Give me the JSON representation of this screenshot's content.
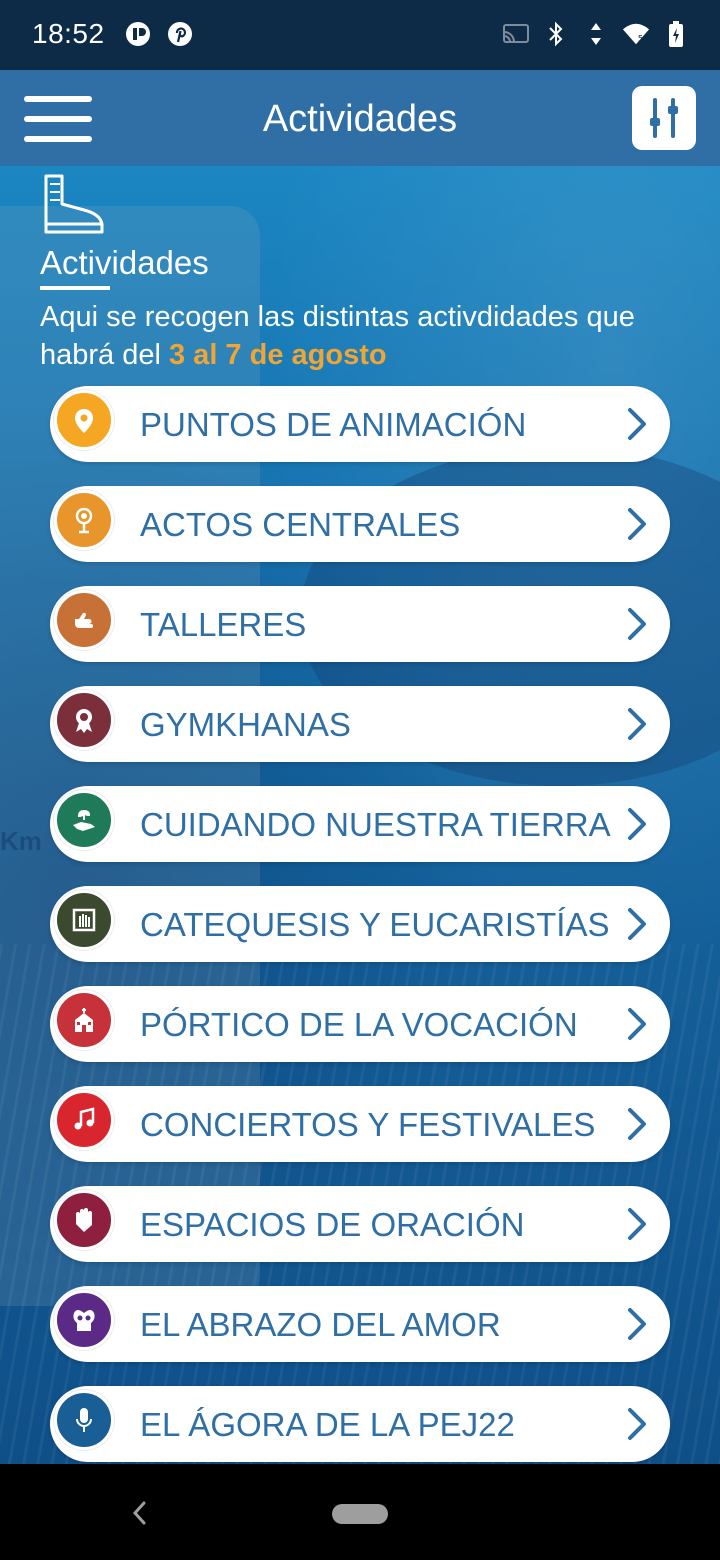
{
  "status_bar": {
    "time": "18:52",
    "left_icons": [
      "notification-app-icon",
      "pinterest-icon"
    ],
    "right_icons": [
      "cast-icon",
      "bluetooth-icon",
      "data-arrows-icon",
      "wifi-icon",
      "battery-icon"
    ]
  },
  "app_bar": {
    "title": "Actividades",
    "menu_icon": "hamburger-icon",
    "filter_icon": "sliders-icon"
  },
  "section": {
    "icon": "boot-icon",
    "title": "Actividades",
    "desc_prefix": "Aqui se recogen las distintas activdidades que habrá del ",
    "desc_highlight": "3 al 7 de agosto"
  },
  "colors": {
    "app_bar": "#2f6fa5",
    "status_bar": "#0d2a47",
    "item_text": "#2f6fa5",
    "highlight": "#f0a534"
  },
  "items": [
    {
      "label": "PUNTOS DE ANIMACIÓN",
      "icon": "location-pin-icon",
      "color": "#f5a623"
    },
    {
      "label": "ACTOS CENTRALES",
      "icon": "podium-icon",
      "color": "#e8952b"
    },
    {
      "label": "TALLERES",
      "icon": "hand-icon",
      "color": "#c87137"
    },
    {
      "label": "GYMKHANAS",
      "icon": "award-icon",
      "color": "#7a2f3b"
    },
    {
      "label": "CUIDANDO NUESTRA TIERRA",
      "icon": "plant-in-hand-icon",
      "color": "#1f7a5a"
    },
    {
      "label": "CATEQUESIS Y EUCARISTÍAS",
      "icon": "raised-hand-icon",
      "color": "#3b4a2f"
    },
    {
      "label": "PÓRTICO DE LA VOCACIÓN",
      "icon": "church-icon",
      "color": "#c7323a"
    },
    {
      "label": "CONCIERTOS Y FESTIVALES",
      "icon": "music-note-icon",
      "color": "#d9262e"
    },
    {
      "label": "ESPACIOS DE ORACIÓN",
      "icon": "praying-hands-icon",
      "color": "#8e1f3f"
    },
    {
      "label": "EL ABRAZO DEL AMOR",
      "icon": "embrace-icon",
      "color": "#5b2a86"
    },
    {
      "label": "EL ÁGORA DE LA PEJ22",
      "icon": "microphone-icon",
      "color": "#1a5e96"
    }
  ],
  "nav_bar": {
    "back_icon": "back-chevron-icon",
    "home_icon": "home-pill-icon"
  }
}
